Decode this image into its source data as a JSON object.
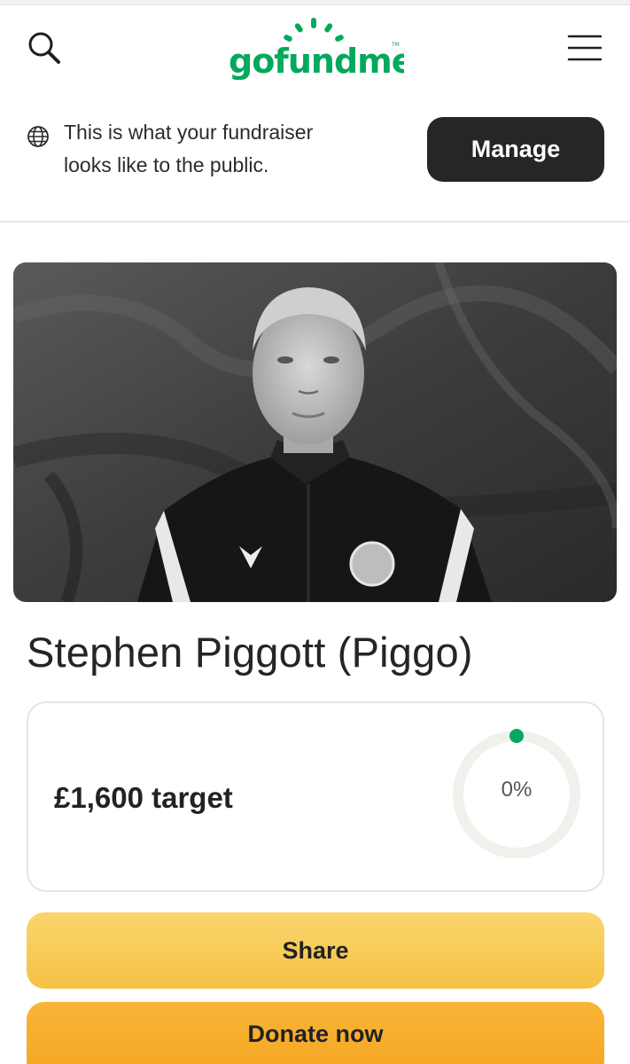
{
  "header": {
    "logo_text": "gofundme",
    "logo_color": "#02a95c"
  },
  "banner": {
    "message": "This is what your fundraiser looks like to the public.",
    "manage_label": "Manage"
  },
  "fundraiser": {
    "title": "Stephen Piggott (Piggo)",
    "target_text": "£1,600 target",
    "progress_text": "0%",
    "progress_fraction": 0,
    "progress_color": "#02a95c"
  },
  "actions": {
    "share_label": "Share",
    "donate_label": "Donate now"
  }
}
